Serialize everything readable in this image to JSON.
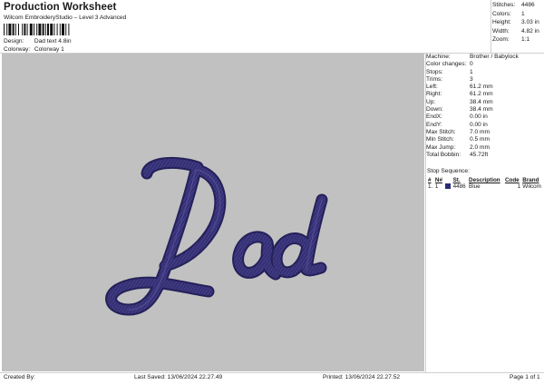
{
  "header": {
    "title": "Production Worksheet",
    "subtitle": "Wilcom EmbroideryStudio – Level 3 Advanced"
  },
  "design": {
    "label": "Design:",
    "value": "Dad text 4.8in"
  },
  "colorway": {
    "label": "Colorway:",
    "value": "Colorway 1"
  },
  "summary": [
    {
      "label": "Stitches:",
      "value": "4486"
    },
    {
      "label": "Colors:",
      "value": "1"
    },
    {
      "label": "Height:",
      "value": "3.03 in"
    },
    {
      "label": "Width:",
      "value": "4.82 in"
    },
    {
      "label": "Zoom:",
      "value": "1:1"
    }
  ],
  "artwork": {
    "text": "Dad",
    "thread_color": "#3f3a82",
    "background_color": "#c1c1c1"
  },
  "machine_info": [
    {
      "label": "Machine:",
      "value": "Brother / Babylock"
    },
    {
      "label": "Color changes:",
      "value": "0"
    },
    {
      "label": "Stops:",
      "value": "1"
    },
    {
      "label": "Trims:",
      "value": "3"
    },
    {
      "label": "Left:",
      "value": "61.2 mm"
    },
    {
      "label": "Right:",
      "value": "61.2 mm"
    },
    {
      "label": "Up:",
      "value": "38.4 mm"
    },
    {
      "label": "Down:",
      "value": "38.4 mm"
    },
    {
      "label": "EndX:",
      "value": "0.00 in"
    },
    {
      "label": "EndY:",
      "value": "0.00 in"
    },
    {
      "label": "Max Stitch:",
      "value": "7.0 mm"
    },
    {
      "label": "Min Stitch:",
      "value": "0.5 mm"
    },
    {
      "label": "Max Jump:",
      "value": "2.0 mm"
    },
    {
      "label": "Total Bobbin:",
      "value": "45.72ft"
    }
  ],
  "stop_sequence": {
    "title": "Stop Sequence:",
    "headers": [
      "#",
      "N#",
      "",
      "St.",
      "Description",
      "Code",
      "Brand"
    ],
    "rows": [
      {
        "index": "1.",
        "needle": "1",
        "color": "#2a2a78",
        "stitches": "4486",
        "description": "Blue",
        "code": "1",
        "brand": "Wilcom"
      }
    ]
  },
  "footer": {
    "created_by": "Created By:",
    "last_saved": "Last Saved: 13/06/2024 22.27.49",
    "printed": "Printed: 13/06/2024 22.27.52",
    "page": "Page 1 of 1"
  }
}
